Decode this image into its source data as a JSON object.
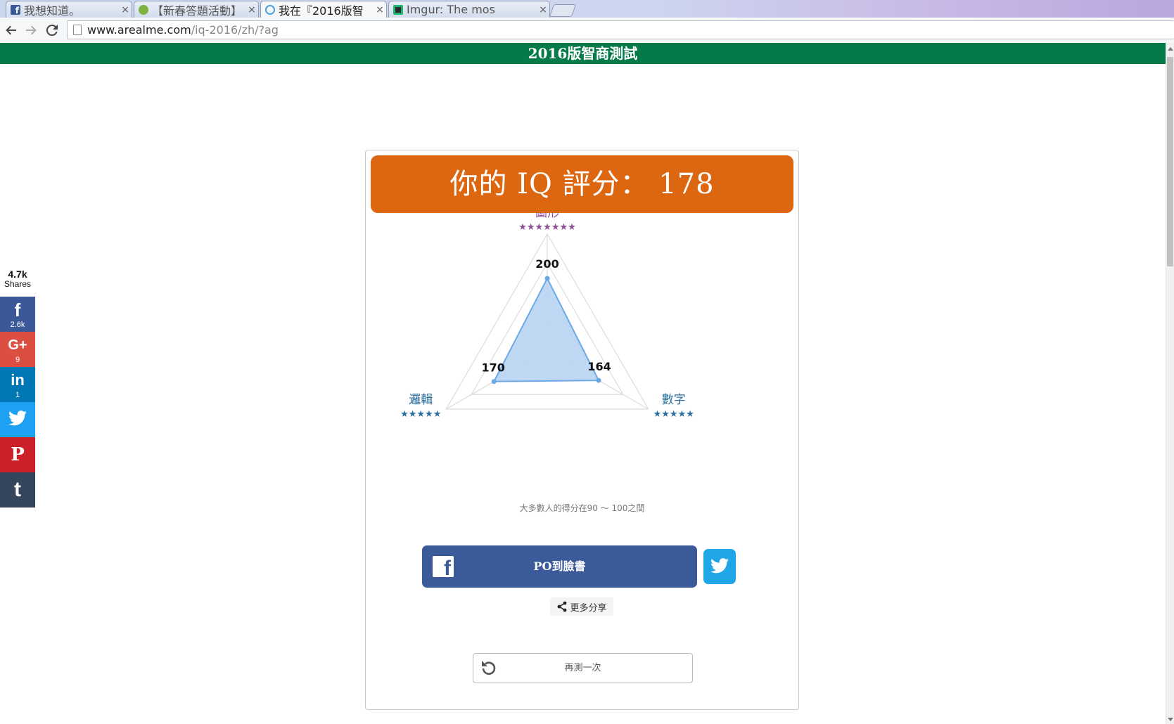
{
  "browser": {
    "tabs": [
      {
        "title": "我想知道。",
        "favicon_color": "#3b5998",
        "active": false
      },
      {
        "title": "【新春答題活動】",
        "favicon_color": "#7cb342",
        "active": false
      },
      {
        "title": "我在『2016版智",
        "favicon_color": "#4aa3df",
        "active": true
      },
      {
        "title": "Imgur: The mos",
        "favicon_color": "#1bb76e",
        "active": false
      }
    ],
    "close_glyph": "×",
    "url_host": "www.arealme.com",
    "url_path": "/iq-2016/zh/?ag"
  },
  "site": {
    "header_title": "2016版智商測試"
  },
  "share_bar": {
    "total": "4.7k",
    "total_label": "Shares",
    "buttons": [
      {
        "network": "facebook",
        "glyph": "f",
        "count": "2.6k",
        "color": "#3b5998"
      },
      {
        "network": "google-plus",
        "glyph": "G+",
        "count": "9",
        "color": "#dc4e41"
      },
      {
        "network": "linkedin",
        "glyph": "in",
        "count": "1",
        "color": "#0077b5"
      },
      {
        "network": "twitter",
        "glyph": "",
        "count": "",
        "color": "#1da1f2"
      },
      {
        "network": "pinterest",
        "glyph": "P",
        "count": "",
        "color": "#cb2027"
      },
      {
        "network": "tumblr",
        "glyph": "t",
        "count": "",
        "color": "#35465c"
      }
    ]
  },
  "result": {
    "banner": "你的 IQ 評分： 178",
    "banner_color": "#dd6610",
    "note": "大多數人的得分在90 ～ 100之間",
    "fb_button_label": "PO到臉書",
    "more_share_label": "更多分享",
    "retry_label": "再測一次"
  },
  "radar": {
    "axes": [
      {
        "name": "圖形",
        "stars": "★★★★★★★",
        "value": 200,
        "value_label": "200",
        "color": "#8e4f96"
      },
      {
        "name": "數字",
        "stars": "★★★★★",
        "value": 164,
        "value_label": "164",
        "color": "#2a6f9e"
      },
      {
        "name": "邏輯",
        "stars": "★★★★★",
        "value": 170,
        "value_label": "170",
        "color": "#2a6f9e"
      }
    ],
    "fill_color": "#b8d4f2",
    "line_color": "#6aa8e8"
  }
}
